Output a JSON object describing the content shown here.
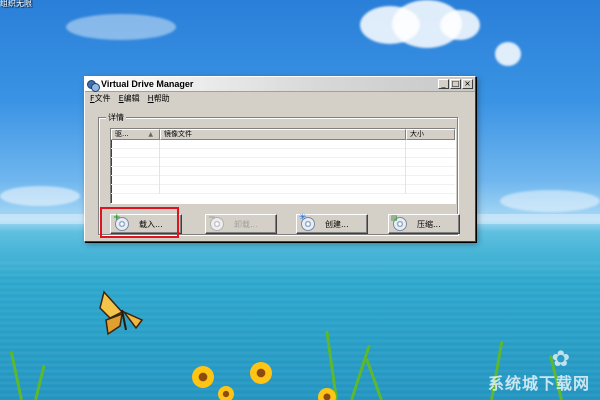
{
  "desktop": {
    "top_label": "组织无限"
  },
  "window": {
    "title": "Virtual Drive Manager",
    "controls": {
      "minimize": "_",
      "maximize": "□",
      "close": "×"
    }
  },
  "menu": [
    {
      "key": "F",
      "label": "文件"
    },
    {
      "key": "E",
      "label": "编辑"
    },
    {
      "key": "H",
      "label": "帮助"
    }
  ],
  "details": {
    "group_label": "详情",
    "columns": {
      "drive": "驱...",
      "image_file": "镜像文件",
      "size": "大小"
    },
    "rows": []
  },
  "buttons": {
    "load": {
      "label": "载入...",
      "icon": "disc-add-icon",
      "enabled": true,
      "highlighted": true
    },
    "unload": {
      "label": "卸载...",
      "icon": "disc-eject-icon",
      "enabled": false
    },
    "create": {
      "label": "创建...",
      "icon": "disc-create-icon",
      "enabled": true
    },
    "compress": {
      "label": "压缩...",
      "icon": "disc-compress-icon",
      "enabled": true
    }
  },
  "colors": {
    "highlight_box": "#e0141e"
  },
  "watermark": {
    "text": "系统城下载网"
  }
}
